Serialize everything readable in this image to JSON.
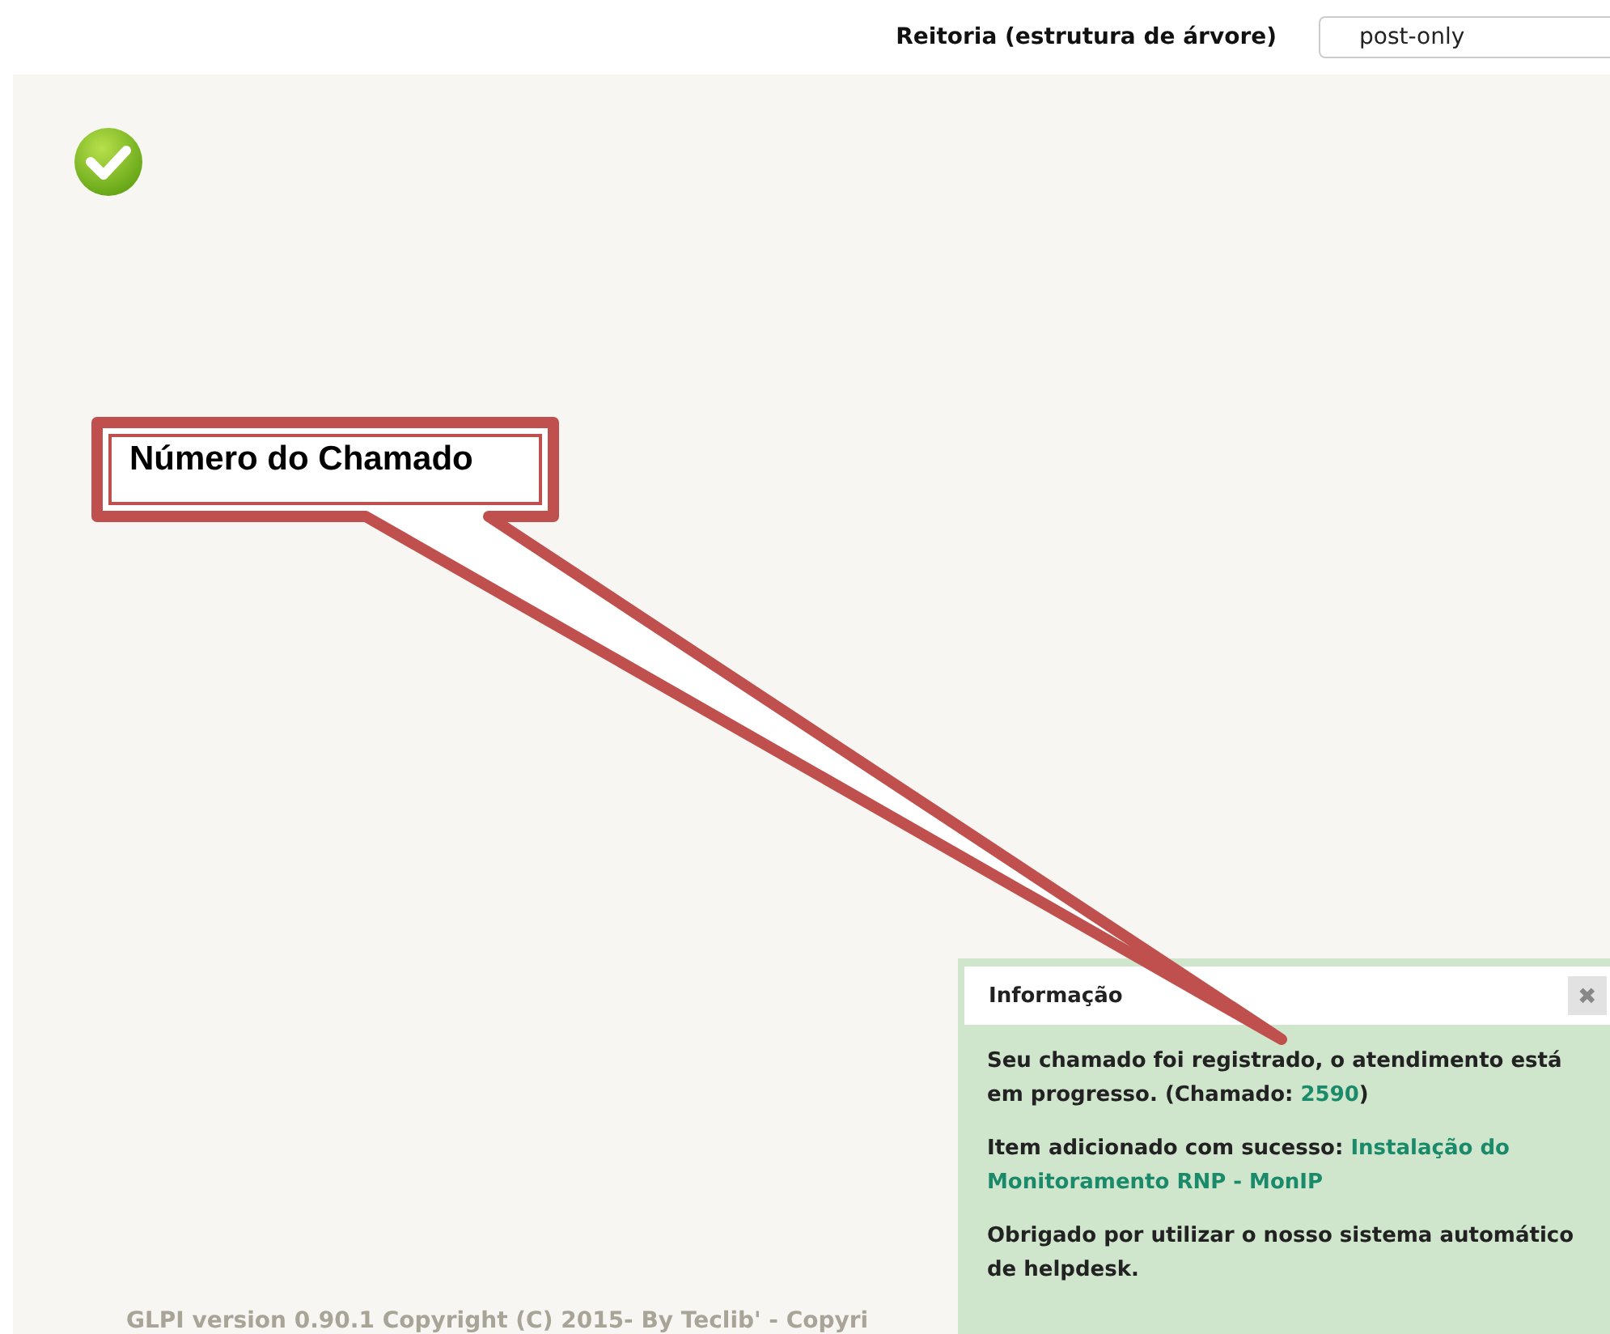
{
  "header": {
    "entity_label": "Reitoria (estrutura de árvore)",
    "profile_select": {
      "value": "post-only"
    }
  },
  "status": {
    "kind": "success"
  },
  "callout": {
    "text": "Número do Chamado"
  },
  "footer": {
    "text": "GLPI version 0.90.1 Copyright (C) 2015- By Teclib' - Copyri"
  },
  "info_panel": {
    "title": "Informação",
    "close": "✖",
    "messages": [
      {
        "parts": [
          {
            "text": "Seu chamado foi registrado, o atendimento está em progresso. (Chamado: ",
            "kind": "text"
          },
          {
            "text": "2590",
            "kind": "link"
          },
          {
            "text": ")",
            "kind": "text"
          }
        ]
      },
      {
        "parts": [
          {
            "text": "Item adicionado com sucesso: ",
            "kind": "text"
          },
          {
            "text": "Instalação do",
            "kind": "link"
          },
          {
            "text": "Monitoramento RNP - MonIP",
            "kind": "link"
          }
        ]
      },
      {
        "parts": [
          {
            "text": "Obrigado por utilizar o nosso sistema automático de helpdesk.",
            "kind": "text"
          }
        ]
      }
    ]
  }
}
